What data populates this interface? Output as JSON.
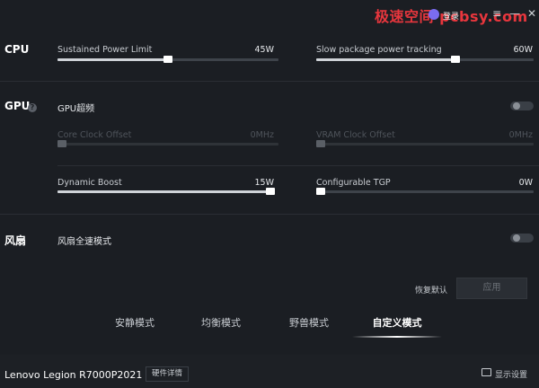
{
  "titlebar": {
    "watermark": "极速空间 pcbsy.com",
    "login": "登录",
    "menu_glyph": "≡",
    "minimize_glyph": "—",
    "close_glyph": "✕"
  },
  "cpu": {
    "title": "CPU",
    "spl": {
      "label": "Sustained Power Limit",
      "value": "45W",
      "fraction": 0.5
    },
    "sppt": {
      "label": "Slow package power tracking",
      "value": "60W",
      "fraction": 0.64
    }
  },
  "gpu": {
    "title": "GPU",
    "help_glyph": "?",
    "overclock_label": "GPU超频",
    "core_clock": {
      "label": "Core Clock Offset",
      "value": "0MHz",
      "fraction": 0.0
    },
    "vram_clock": {
      "label": "VRAM Clock Offset",
      "value": "0MHz",
      "fraction": 0.0
    },
    "dynamic_boost": {
      "label": "Dynamic Boost",
      "value": "15W",
      "fraction": 1.0
    },
    "tgp": {
      "label": "Configurable TGP",
      "value": "0W",
      "fraction": 0.0
    }
  },
  "fan": {
    "title": "风扇",
    "full_speed_label": "风扇全速模式"
  },
  "actions": {
    "reset": "恢复默认",
    "apply": "应用"
  },
  "modes": [
    {
      "label": "安静模式",
      "active": false
    },
    {
      "label": "均衡模式",
      "active": false
    },
    {
      "label": "野兽模式",
      "active": false
    },
    {
      "label": "自定义模式",
      "active": true
    }
  ],
  "footer": {
    "device": "Lenovo Legion R7000P2021",
    "hw_details": "硬件详情",
    "display_settings": "显示设置"
  }
}
